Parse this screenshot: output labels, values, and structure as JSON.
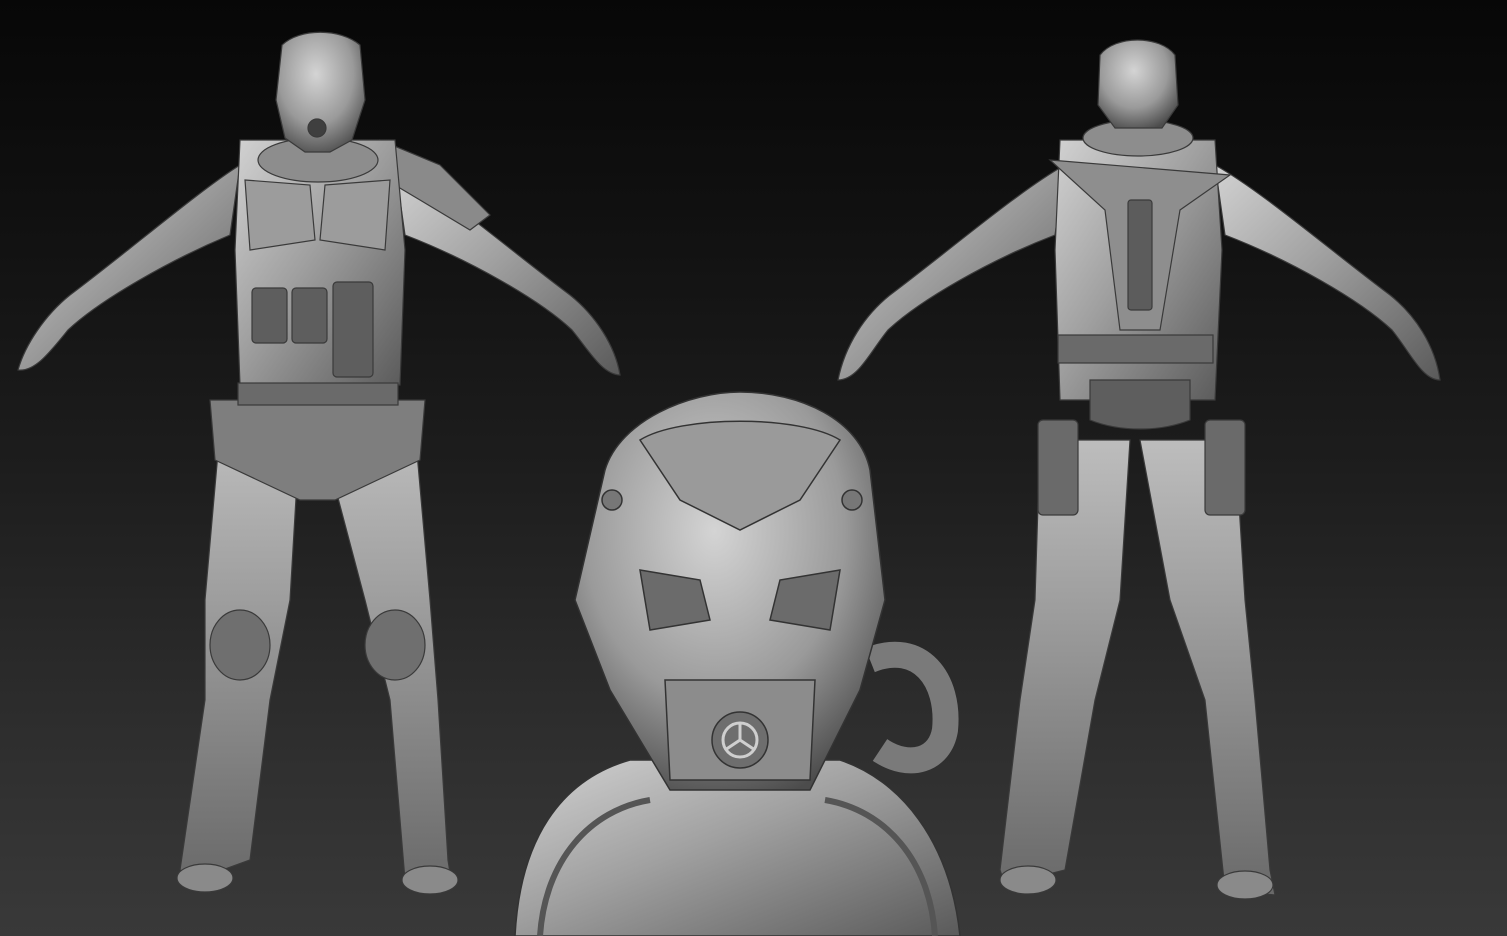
{
  "scene": {
    "kind": "3D sculpt render sheet",
    "views": [
      "front-view",
      "back-view",
      "helmet-closeup"
    ],
    "colors": {
      "background_top": "#070707",
      "background_bottom": "#393939",
      "clay_light": "#c9c9c9",
      "clay_mid": "#8f8f8f",
      "clay_dark": "#4a4a4a"
    }
  }
}
